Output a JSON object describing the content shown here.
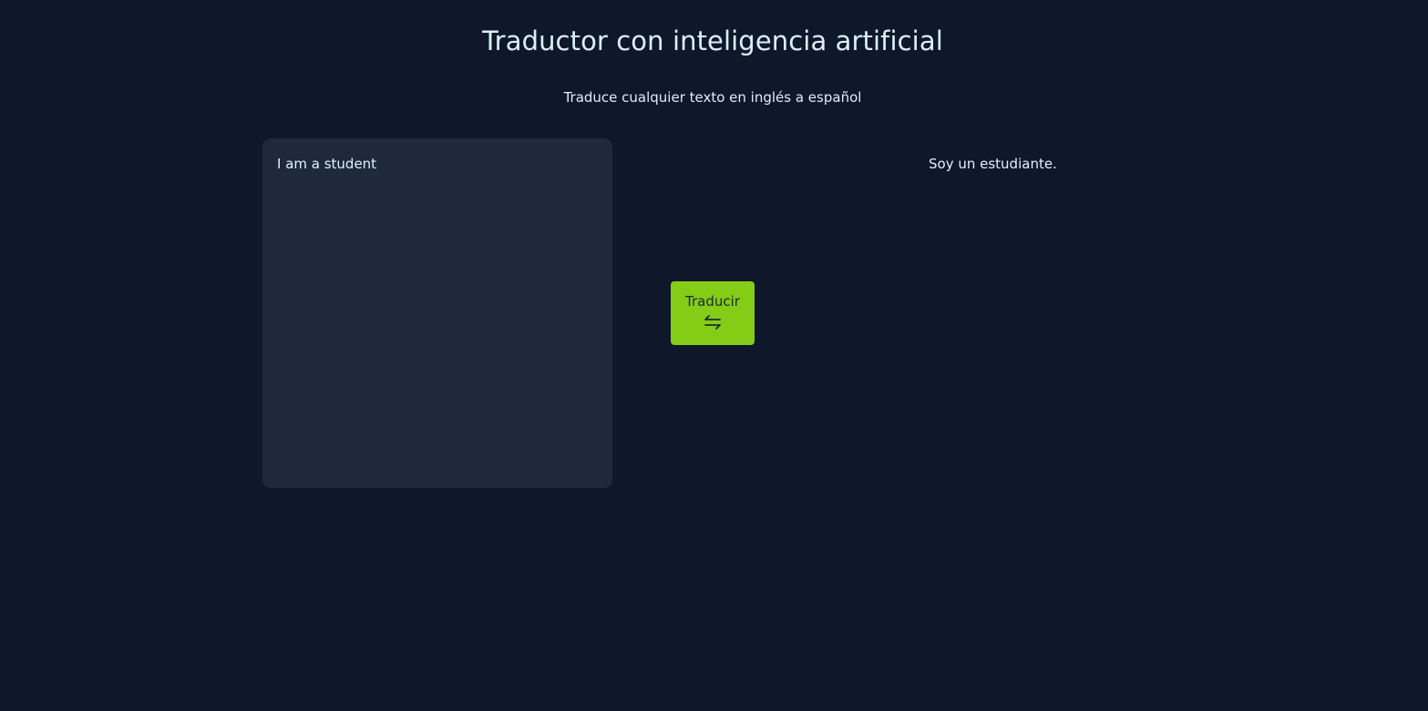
{
  "header": {
    "title": "Traductor con inteligencia artificial",
    "subtitle": "Traduce cualquier texto en inglés a español"
  },
  "translator": {
    "source_text": "I am a student",
    "button_label": "Traducir",
    "button_icon": "swap-arrows-icon",
    "result_text": "Soy un estudiante."
  },
  "colors": {
    "background": "#0f172a",
    "panel": "#1e293b",
    "accent": "#84cc16",
    "text": "#e0f2fe"
  }
}
